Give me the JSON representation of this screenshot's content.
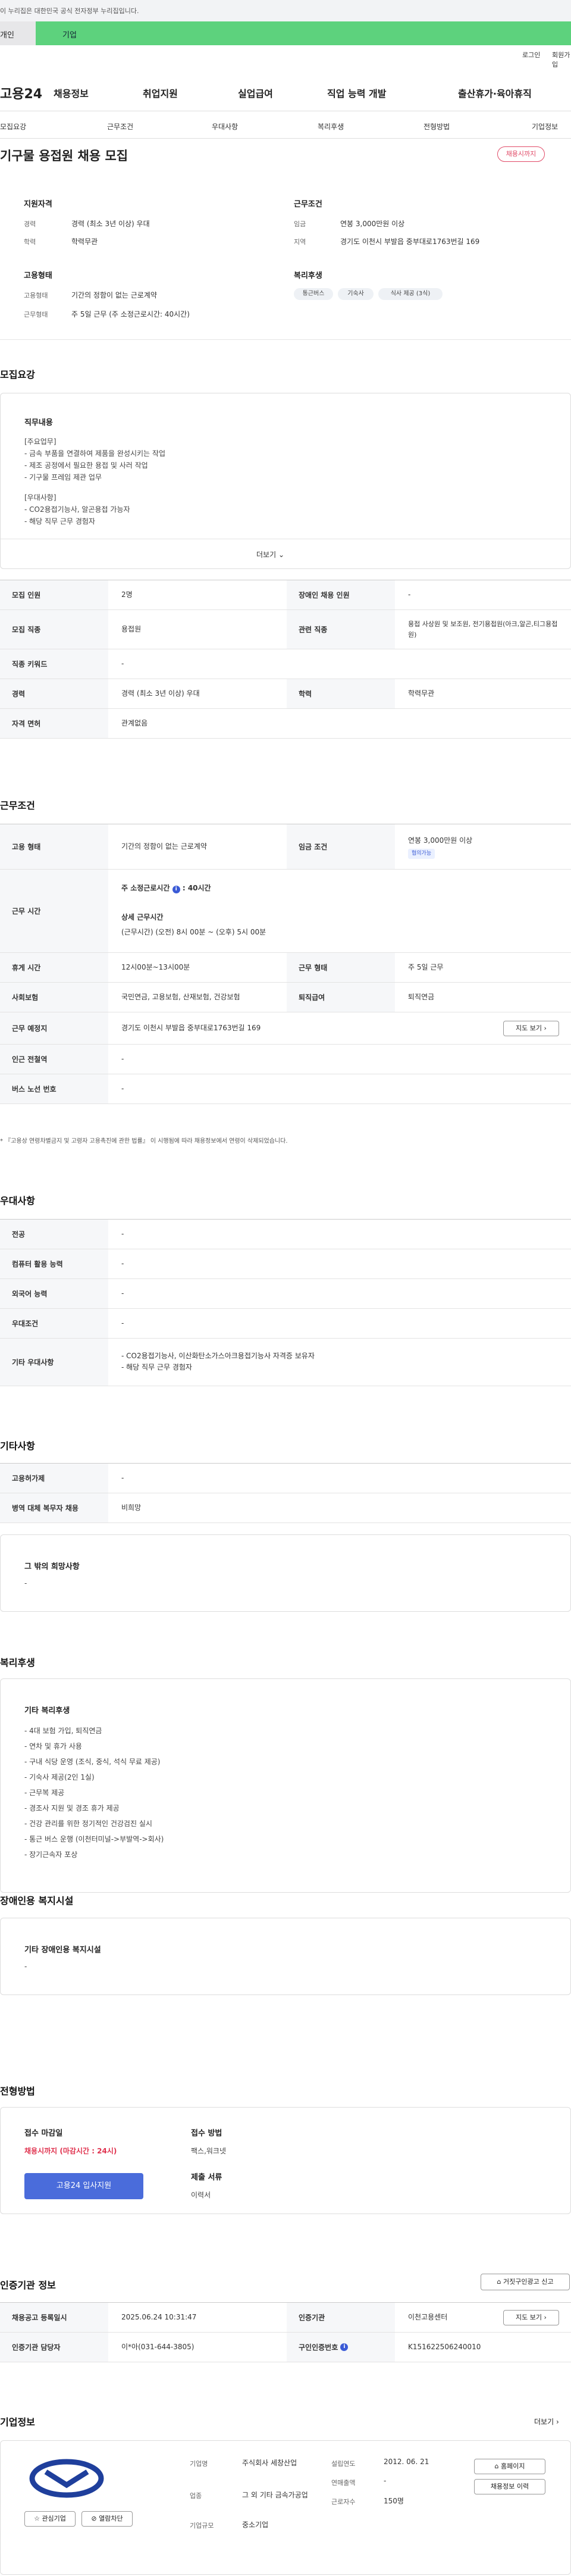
{
  "gov_banner": "이 누리집은 대한민국 공식 전자정부 누리집입니다.",
  "top_tabs": [
    "개인",
    "기업"
  ],
  "util_links": [
    "로그인",
    "회원가입"
  ],
  "brand": {
    "logo": "고용24",
    "accent": "#4a6cdb",
    "green": "#5dd27d"
  },
  "menu": [
    "채용정보",
    "취업지원",
    "실업급여",
    "직업 능력 개발",
    "출산휴가·육아휴직"
  ],
  "tabs": [
    "모집요강",
    "근무조건",
    "우대사항",
    "복리후생",
    "전형방법",
    "기업정보"
  ],
  "job": {
    "title": "기구물 용접원 채용 모집",
    "status": "채용시까지",
    "qual_title": "지원자격",
    "career_l": "경력",
    "career_v": "경력 (최소 3년 이상) 우대",
    "edu_l": "학력",
    "edu_v": "학력무관",
    "cond_title": "근무조건",
    "wage_l": "임금",
    "wage_v": "연봉 3,000만원 이상",
    "area_l": "지역",
    "area_v": "경기도 이천시 부발읍 중부대로1763번길 169",
    "emp_title": "고용형태",
    "emp_l": "고용형태",
    "emp_v": "기간의 정함이 없는 근로계약",
    "type_l": "근무형태",
    "type_v": "주 5일 근무 (주 소정근로시간: 40시간)",
    "welfare_title": "복리후생",
    "chips": [
      "통근버스",
      "기숙사",
      "식사 제공 (3식)"
    ]
  },
  "s1": {
    "title": "모집요강",
    "box_title": "직무내용",
    "lines": [
      "[주요업무]",
      "- 금속 부품을 연결하여 제품을 완성시키는 작업",
      "- 제조 공정에서 필요한 용접 및 사러 작업",
      "- 기구물 프레임 제관 업무",
      "",
      "[우대사항]",
      "- CO2용접기능사, 알곤용접 가능자",
      "- 해당 직무 근무 경험자"
    ],
    "more": "더보기"
  },
  "recruit_table": [
    {
      "h1": "모집 인원",
      "v1": "2명",
      "h2": "장애인 채용 인원",
      "v2": "-"
    },
    {
      "h1": "모집 직종",
      "v1": "용접원",
      "h2": "관련 직종",
      "v2": "용접 사상원 및 보조원, 전기용접원(아크,알곤,티그용접원)"
    },
    {
      "h1": "직종 키워드",
      "v1": "-"
    },
    {
      "h1": "경력",
      "v1": "경력 (최소 3년 이상) 우대",
      "h2": "학력",
      "v2": "학력무관"
    },
    {
      "h1": "자격 면허",
      "v1": "관계없음"
    }
  ],
  "s2": {
    "title": "근무조건"
  },
  "work": {
    "emp_h": "고용 형태",
    "emp_v": "기간의 정함이 없는 근로계약",
    "wage_h": "임금 조건",
    "wage_v": "연봉 3,000만원 이상",
    "wage_tag": "협의가능",
    "time_h": "근무 시간",
    "time_v1": "주 소정근로시간",
    "time_v2": "40시간",
    "time_sub": "상세 근무시간",
    "time_det": "(근무시간) (오전) 8시 00분 ~ (오후) 5시 00분",
    "rest_h": "휴게 시간",
    "rest_v": "12시00분~13시00분",
    "form_h": "근무 형태",
    "form_v": "주 5일 근무",
    "ins_h": "사회보험",
    "ins_v": "국민연금, 고용보험, 산재보험, 건강보험",
    "ret_h": "퇴직급여",
    "ret_v": "퇴직연금",
    "place_h": "근무 예정지",
    "place_v": "경기도 이천시 부발읍 중부대로1763번길 169",
    "map_btn": "지도 보기",
    "sub_h": "인근 전철역",
    "sub_v": "-",
    "bus_h": "버스 노선 번호",
    "bus_v": "-",
    "note": "* 『고용상 연령차별금지 및 고령자 고용촉진에 관한 법률』 이 시행됨에 따라 채용정보에서 연령이 삭제되었습니다."
  },
  "s3": {
    "title": "우대사항",
    "rows": [
      {
        "h": "전공",
        "v": "-"
      },
      {
        "h": "컴퓨터 활용 능력",
        "v": "-"
      },
      {
        "h": "외국어 능력",
        "v": "-"
      },
      {
        "h": "우대조건",
        "v": "-"
      },
      {
        "h": "기타 우대사항",
        "v1": "- CO2용접기능사, 이산화탄소가스아크용접기능사 자격증 보유자",
        "v2": "- 해당 직무 근무 경험자"
      }
    ]
  },
  "s4": {
    "title": "기타사항",
    "rows": [
      {
        "h": "고용허가제",
        "v": "-"
      },
      {
        "h": "병역 대체 복무자 채용",
        "v": "비희망"
      }
    ],
    "box_title": "그 밖의 희망사항",
    "box_v": "-"
  },
  "s5": {
    "title": "복리후생",
    "box_title": "기타 복리후생",
    "items": [
      "- 4대 보험 가입, 퇴직연금",
      "- 연차 및 휴가 사용",
      "- 구내 식당 운영 (조식, 중식, 석식 무료 제공)",
      "- 기숙사 제공(2인 1실)",
      "- 근무복 제공",
      "- 경조사 지원 및 경조 휴가 제공",
      "- 건강 관리를 위한 정기적인 건강검진 실시",
      "- 통근 버스 운행 (이천터미널->부발역->회사)",
      "- 장기근속자 포상"
    ]
  },
  "s6": {
    "title": "장애인용 복지시설",
    "box_title": "기타 장애인용 복지시설",
    "box_v": "-"
  },
  "s7": {
    "title": "전형방법",
    "deadline_l": "접수 마감일",
    "deadline_v": "채용시까지 (마감시간 : 24시)",
    "apply_btn": "고용24 입사지원",
    "method_l": "접수 방법",
    "method_v": "팩스,워크넷",
    "docs_l": "제출 서류",
    "docs_v": "이력서"
  },
  "s8": {
    "title": "인증기관 정보",
    "report_btn": "거짓구인광고 신고",
    "reg_h": "채용공고 등록일시",
    "reg_v": "2025.06.24 10:31:47",
    "org_h": "인증기관",
    "org_v": "이천고용센터",
    "map_btn": "지도 보기",
    "mgr_h": "인증기관 담당자",
    "mgr_v": "이*아(031-644-3805)",
    "no_h": "구인인증번호",
    "no_v": "K151622506240010"
  },
  "s9": {
    "title": "기업정보",
    "more": "더보기",
    "ind_l": "기업명",
    "ind_v": "주식회사 세창산업",
    "biz_l": "업종",
    "biz_v": "그 외 기타 금속가공업",
    "size_l": "기업규모",
    "size_v": "중소기업",
    "found_l": "설립연도",
    "found_v": "2012. 06. 21",
    "sales_l": "연매출액",
    "sales_v": "-",
    "emp_l": "근로자수",
    "emp_v": "150명",
    "fav_btn": "관심기업",
    "block_btn": "열람차단",
    "home_btn": "홈페이지",
    "hist_btn": "채용정보 이력"
  }
}
